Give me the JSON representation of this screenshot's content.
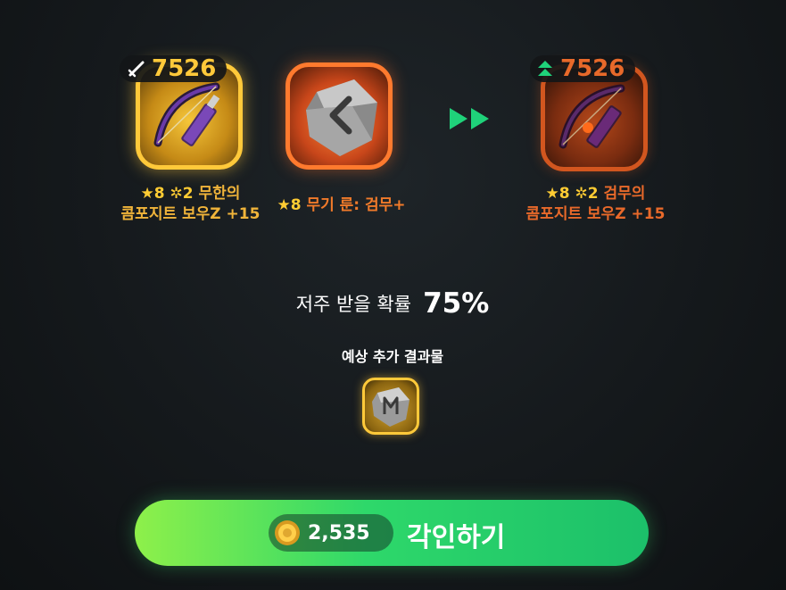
{
  "source_item": {
    "power": "7526",
    "stars": "★8",
    "enchant": "✲2",
    "name_line1": "무한의",
    "name_line2": "콤포지트 보우Z +15"
  },
  "rune_item": {
    "stars": "★8",
    "name": "무기 룬: 검무+"
  },
  "result_item": {
    "power": "7526",
    "stars": "★8",
    "enchant": "✲2",
    "name_line1": "검무의",
    "name_line2": "콤포지트 보우Z +15"
  },
  "curse": {
    "label": "저주 받을 확률",
    "value": "75%"
  },
  "extra_result": {
    "label": "예상 추가 결과물"
  },
  "action": {
    "cost": "2,535",
    "label": "각인하기"
  },
  "colors": {
    "gold": "#ffc93a",
    "orange": "#ff7a2e",
    "green_button": "#1fc86f",
    "result_text": "#e8692a"
  }
}
